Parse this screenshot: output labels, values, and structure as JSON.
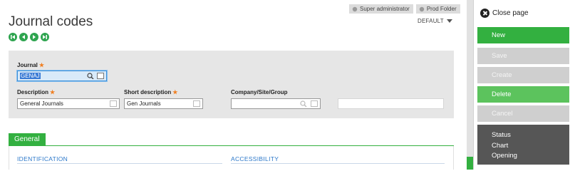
{
  "header": {
    "user_badge": "Super administrator",
    "folder_badge": "Prod Folder",
    "title": "Journal codes",
    "view_select": "DEFAULT"
  },
  "form": {
    "journal": {
      "label": "Journal",
      "value": "GENAJ"
    },
    "description": {
      "label": "Description",
      "value": "General Journals"
    },
    "short_description": {
      "label": "Short description",
      "value": "Gen Journals"
    },
    "company": {
      "label": "Company/Site/Group",
      "value": ""
    },
    "extra": {
      "value": ""
    }
  },
  "tabs": [
    {
      "label": "General"
    }
  ],
  "sections": {
    "identification": "IDENTIFICATION",
    "accessibility": "ACCESSIBILITY"
  },
  "actions": {
    "close_page": "Close page",
    "new": "New",
    "save": "Save",
    "create": "Create",
    "delete": "Delete",
    "cancel": "Cancel",
    "more": [
      "Status",
      "Chart",
      "Opening"
    ]
  },
  "colors": {
    "accent_green": "#33b040",
    "section_blue": "#2b77c9",
    "required_orange": "#f07f22"
  }
}
